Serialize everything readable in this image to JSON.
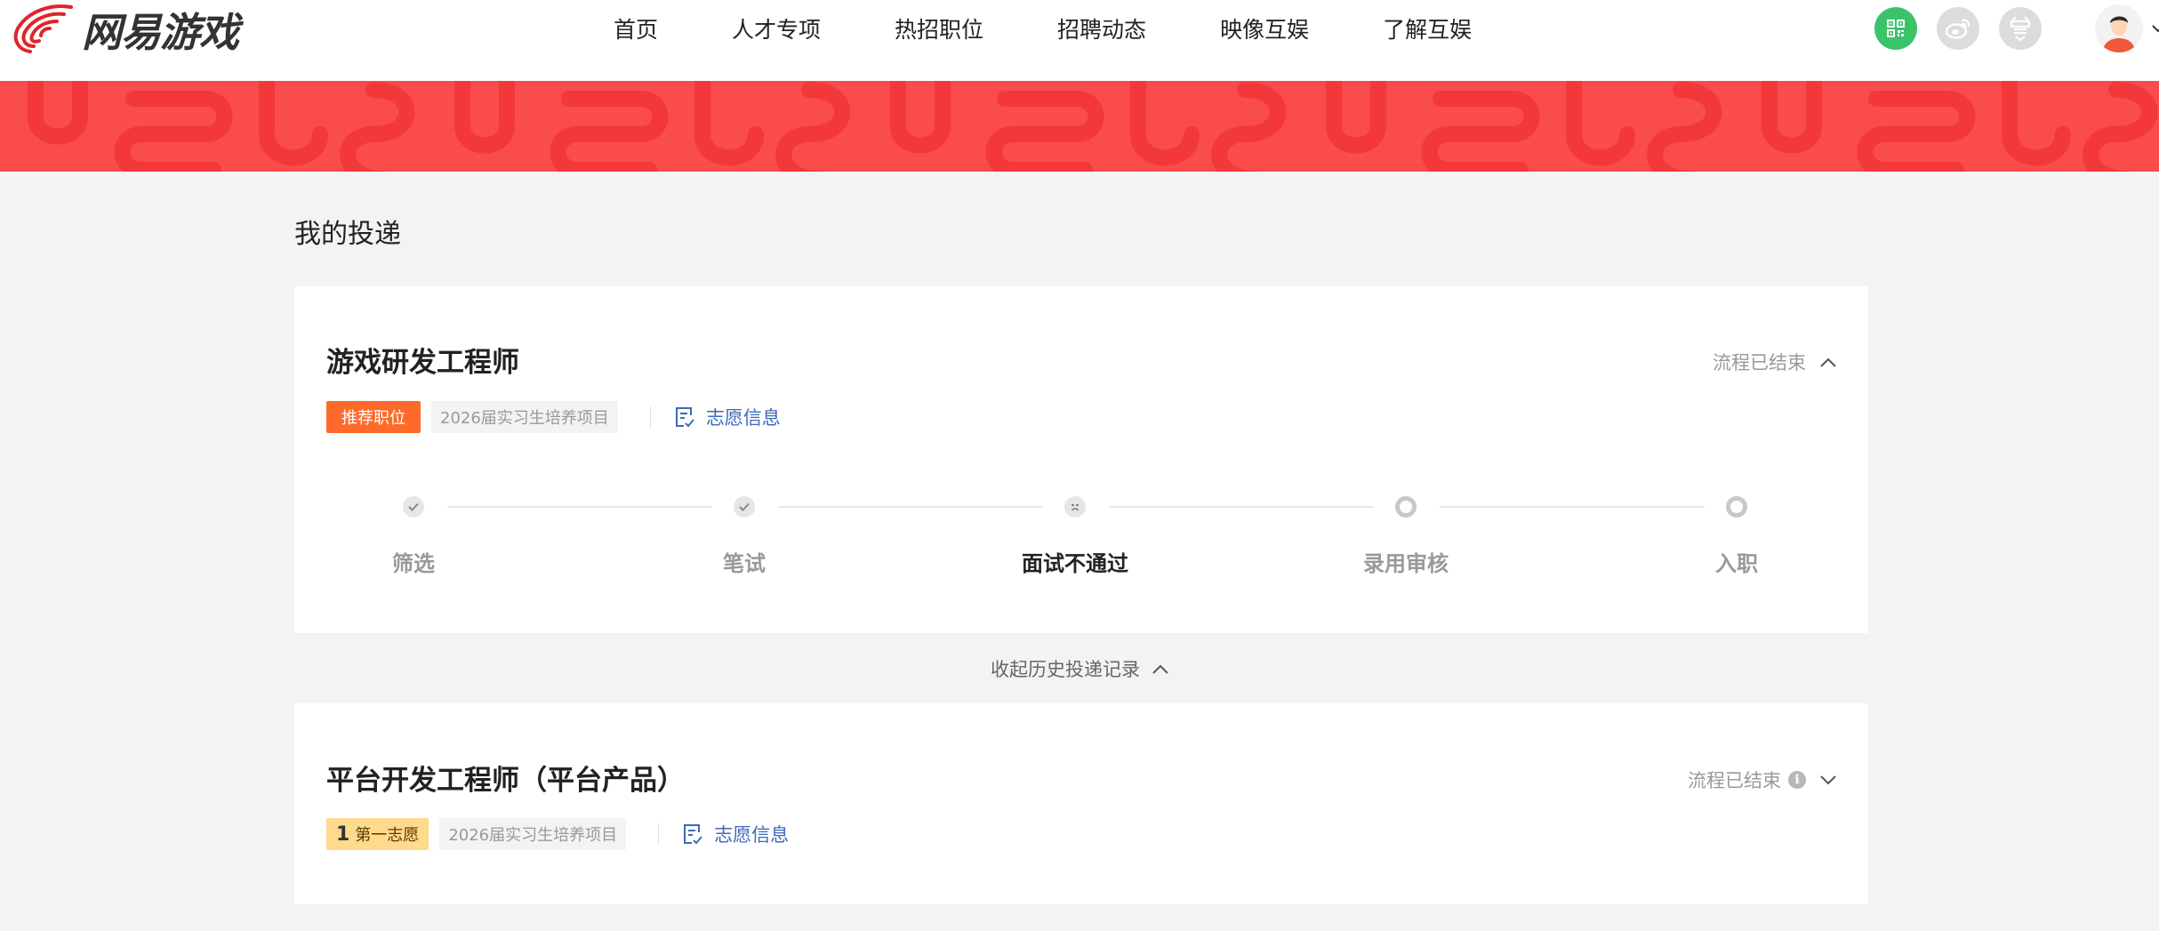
{
  "brand": {
    "logo_text": "网易游戏"
  },
  "nav": {
    "items": [
      "首页",
      "人才专项",
      "热招职位",
      "招聘动态",
      "映像互娱",
      "了解互娱"
    ]
  },
  "header_icons": [
    "qrcode-icon",
    "weibo-icon",
    "bilibili-icon",
    "avatar"
  ],
  "page": {
    "title": "我的投递"
  },
  "applications": [
    {
      "title": "游戏研发工程师",
      "status": "流程已结束",
      "tag": "推荐职位",
      "project": "2026届实习生培养项目",
      "wish_label": "志愿信息",
      "steps": [
        {
          "label": "筛选",
          "state": "done"
        },
        {
          "label": "笔试",
          "state": "done"
        },
        {
          "label": "面试不通过",
          "state": "fail"
        },
        {
          "label": "录用审核",
          "state": "todo"
        },
        {
          "label": "入职",
          "state": "todo"
        }
      ]
    },
    {
      "title": "平台开发工程师（平台产品）",
      "status": "流程已结束",
      "priority_num": "1",
      "priority_label": "第一志愿",
      "project": "2026届实习生培养项目",
      "wish_label": "志愿信息"
    }
  ],
  "history_toggle": "收起历史投递记录",
  "colors": {
    "banner": "#fa4b4d",
    "accent_orange": "#ff6a2a",
    "link_blue": "#3d6ab8",
    "green_icon": "#3bc36a"
  }
}
